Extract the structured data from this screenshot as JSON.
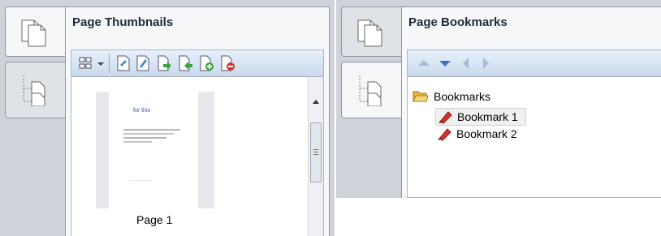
{
  "thumbnails_panel": {
    "title": "Page Thumbnails",
    "tabs": [
      {
        "icon": "pages-icon",
        "active": true
      },
      {
        "icon": "bookmark-tree-icon",
        "active": false
      }
    ],
    "toolbar": [
      "thumbnail-size-icon",
      "dropdown-arrow-icon",
      "page-edit-icon",
      "page-pen-icon",
      "page-insert-icon",
      "page-extract-icon",
      "page-add-icon",
      "page-delete-icon"
    ],
    "thumbnail": {
      "label": "Page 1",
      "doc_title": "for this",
      "doc_link": "............"
    }
  },
  "bookmarks_panel": {
    "title": "Page Bookmarks",
    "tabs": [
      {
        "icon": "pages-icon",
        "active": false
      },
      {
        "icon": "bookmark-tree-icon",
        "active": true
      }
    ],
    "toolbar": [
      "move-up-icon",
      "move-down-icon",
      "move-left-icon",
      "move-right-icon"
    ],
    "tree": {
      "root": "Bookmarks",
      "items": [
        {
          "label": "Bookmark 1",
          "selected": true
        },
        {
          "label": "Bookmark 2",
          "selected": false
        }
      ]
    }
  },
  "colors": {
    "panel_bg": "#cfd3d9",
    "toolbar_blue": "#c9d9ec",
    "bookmark_red": "#d9312b",
    "folder_yellow": "#f2c94c"
  }
}
